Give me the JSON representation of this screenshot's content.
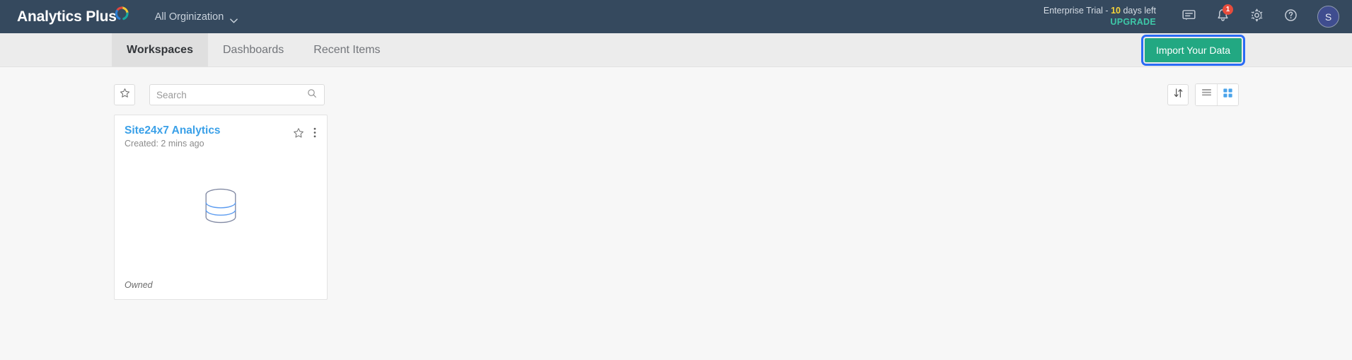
{
  "header": {
    "brand_name": "Analytics Plus",
    "brand_mark_icon": "analytics-plus-logo-arc",
    "org_selector_label": "All Orginization",
    "org_chevron_icon": "chevron-down-icon",
    "trial_prefix": "Enterprise Trial - ",
    "trial_days": "10",
    "trial_suffix": " days left",
    "upgrade_label": "UPGRADE",
    "chat_icon": "chat-bubble-icon",
    "bell_icon": "bell-icon",
    "notification_count": "1",
    "settings_icon": "gear-icon",
    "help_icon": "help-circle-icon",
    "avatar_initial": "S"
  },
  "tabbar": {
    "tabs": [
      {
        "label": "Workspaces",
        "active": true
      },
      {
        "label": "Dashboards",
        "active": false
      },
      {
        "label": "Recent Items",
        "active": false
      }
    ],
    "import_label": "Import Your Data"
  },
  "toolbar": {
    "favorite_icon": "star-outline-icon",
    "search_placeholder": "Search",
    "search_value": "",
    "search_icon": "search-icon",
    "sort_icon": "sort-arrows-icon",
    "list_view_icon": "list-view-icon",
    "grid_view_icon": "grid-view-icon",
    "active_view": "grid"
  },
  "workspaces": [
    {
      "title": "Site24x7 Analytics",
      "created": "Created: 2 mins ago",
      "thumbnail_icon": "database-cylinder-icon",
      "star_icon": "star-outline-icon",
      "more_icon": "more-vertical-icon",
      "ownership": "Owned"
    }
  ],
  "colors": {
    "header_bg": "#35495e",
    "tabbar_bg": "#ececec",
    "content_bg": "#f7f7f7",
    "accent_green": "#22a882",
    "focus_blue": "#2a6bf5",
    "link_blue": "#3aa0e8",
    "trial_yellow": "#f5d33a",
    "upgrade_teal": "#3ec8a8",
    "badge_red": "#e74c3c",
    "avatar_bg": "#3f4d8f"
  }
}
